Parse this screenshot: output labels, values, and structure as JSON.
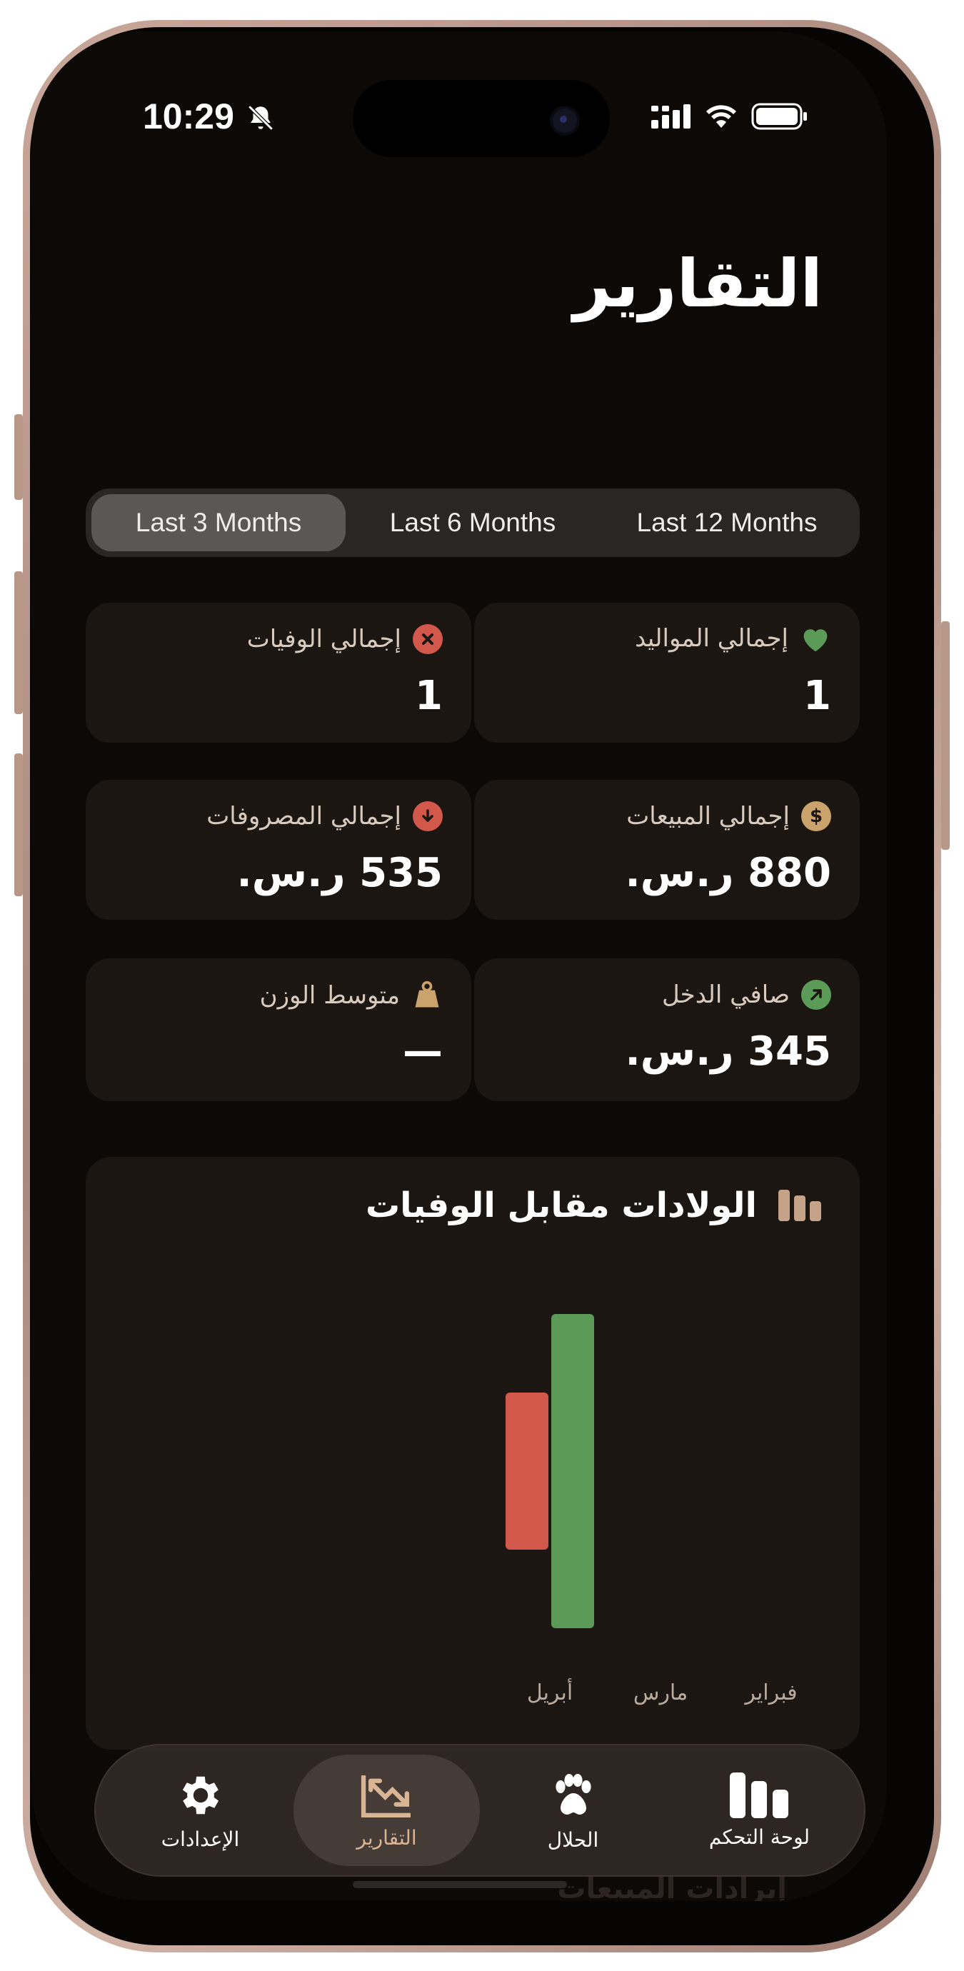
{
  "status_bar": {
    "time": "10:29"
  },
  "page": {
    "title": "التقارير"
  },
  "period_selector": {
    "options": [
      "Last 3 Months",
      "Last 6 Months",
      "Last 12 Months"
    ],
    "selected": "Last 3 Months"
  },
  "stats": {
    "births": {
      "label": "إجمالي المواليد",
      "value": "1",
      "icon": "heart-icon",
      "color": "#5b9b57"
    },
    "deaths": {
      "label": "إجمالي الوفيات",
      "value": "1",
      "icon": "x-circle-icon",
      "color": "#d1584a"
    },
    "sales": {
      "label": "إجمالي المبيعات",
      "value": "880 ر.س.",
      "icon": "dollar-icon",
      "color": "#caa36c"
    },
    "expenses": {
      "label": "إجمالي المصروفات",
      "value": "535 ر.س.",
      "icon": "arrow-down-circle-icon",
      "color": "#d1584a"
    },
    "net_income": {
      "label": "صافي الدخل",
      "value": "345 ر.س.",
      "icon": "trend-up-icon",
      "color": "#5b9b57"
    },
    "avg_weight": {
      "label": "متوسط الوزن",
      "value": "—",
      "icon": "weight-icon",
      "color": "#caa36c"
    }
  },
  "chart_data": {
    "type": "bar",
    "title": "الولادات مقابل الوفيات",
    "categories": [
      "فبراير",
      "مارس",
      "أبريل"
    ],
    "series": [
      {
        "values": [
          0,
          0,
          1
        ],
        "color": "#5b9b57"
      },
      {
        "values": [
          0,
          0,
          0.5
        ],
        "color": "#d1584a"
      }
    ],
    "ylim": [
      0,
      1
    ],
    "grid": false
  },
  "tabbar": {
    "items": [
      {
        "label": "الإعدادات",
        "icon": "gear-icon"
      },
      {
        "label": "التقارير",
        "icon": "chart-trend-icon"
      },
      {
        "label": "الحلال",
        "icon": "paw-icon"
      },
      {
        "label": "لوحة التحكم",
        "icon": "bar-chart-icon"
      }
    ],
    "active": "التقارير"
  },
  "behind_tabbar_text": "إيرادات المبيعات"
}
